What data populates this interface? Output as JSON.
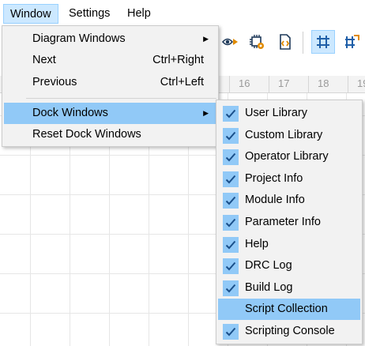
{
  "menubar": {
    "items": [
      {
        "label": "Window"
      },
      {
        "label": "Settings"
      },
      {
        "label": "Help"
      }
    ]
  },
  "ruler": {
    "ticks": [
      "16",
      "17",
      "18",
      "19"
    ]
  },
  "window_menu": {
    "items": [
      {
        "label": "Diagram Windows",
        "shortcut": "",
        "submenu": true
      },
      {
        "label": "Next",
        "shortcut": "Ctrl+Right",
        "submenu": false
      },
      {
        "label": "Previous",
        "shortcut": "Ctrl+Left",
        "submenu": false
      },
      {
        "label": "Dock Windows",
        "shortcut": "",
        "submenu": true
      },
      {
        "label": "Reset Dock Windows",
        "shortcut": "",
        "submenu": false
      }
    ]
  },
  "dock_submenu": {
    "items": [
      {
        "label": "User Library",
        "checked": true
      },
      {
        "label": "Custom Library",
        "checked": true
      },
      {
        "label": "Operator Library",
        "checked": true
      },
      {
        "label": "Project Info",
        "checked": true
      },
      {
        "label": "Module Info",
        "checked": true
      },
      {
        "label": "Parameter Info",
        "checked": true
      },
      {
        "label": "Help",
        "checked": true
      },
      {
        "label": "DRC Log",
        "checked": true
      },
      {
        "label": "Build Log",
        "checked": true
      },
      {
        "label": "Script Collection",
        "checked": false
      },
      {
        "label": "Scripting Console",
        "checked": true
      }
    ]
  },
  "colors": {
    "accent": "#91c9f7",
    "check": "#1a4f8a",
    "icon_orange": "#e08a00",
    "icon_blue": "#1f5fa8"
  }
}
